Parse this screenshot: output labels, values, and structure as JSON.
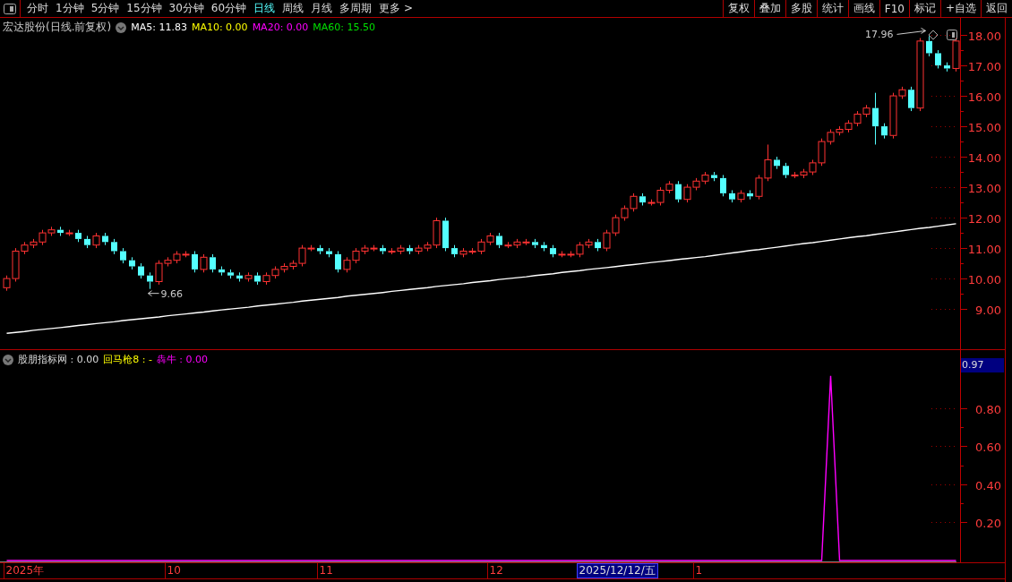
{
  "toolbar": {
    "periods": [
      {
        "label": "分时",
        "selected": false
      },
      {
        "label": "1分钟",
        "selected": false
      },
      {
        "label": "5分钟",
        "selected": false
      },
      {
        "label": "15分钟",
        "selected": false
      },
      {
        "label": "30分钟",
        "selected": false
      },
      {
        "label": "60分钟",
        "selected": false
      },
      {
        "label": "日线",
        "selected": true
      },
      {
        "label": "周线",
        "selected": false
      },
      {
        "label": "月线",
        "selected": false
      },
      {
        "label": "多周期",
        "selected": false
      },
      {
        "label": "更多 >",
        "selected": false
      }
    ],
    "buttons": [
      "复权",
      "叠加",
      "多股",
      "统计",
      "画线",
      "F10",
      "标记",
      "+自选",
      "返回"
    ]
  },
  "price_panel": {
    "title": "宏达股份(日线.前复权)",
    "legend": [
      {
        "label": "MA5: 11.83",
        "color": "#ffffff"
      },
      {
        "label": "MA10: 0.00",
        "color": "#ffff00"
      },
      {
        "label": "MA20: 0.00",
        "color": "#ff00ff"
      },
      {
        "label": "MA60: 15.50",
        "color": "#00e000"
      }
    ],
    "high_mark": "17.96",
    "low_mark": "9.66",
    "chart_data": {
      "type": "line",
      "ylim": [
        7.68,
        18.56
      ],
      "yticks": [
        {
          "value": 9,
          "label": "9.00"
        },
        {
          "value": 10,
          "label": "10.00"
        },
        {
          "value": 11,
          "label": "11.00"
        },
        {
          "value": 12,
          "label": "12.00"
        },
        {
          "value": 13,
          "label": "13.00"
        },
        {
          "value": 14,
          "label": "14.00"
        },
        {
          "value": 15,
          "label": "15.00"
        },
        {
          "value": 16,
          "label": "16.00"
        },
        {
          "value": 17,
          "label": "17.00"
        },
        {
          "value": 18,
          "label": "18.00"
        }
      ],
      "series": [
        {
          "color": "#ffffff",
          "values": [
            8.2,
            8.23,
            8.26,
            8.3,
            8.33,
            8.36,
            8.39,
            8.42,
            8.46,
            8.49,
            8.52,
            8.55,
            8.58,
            8.62,
            8.65,
            8.68,
            8.71,
            8.74,
            8.78,
            8.81,
            8.84,
            8.87,
            8.9,
            8.94,
            8.97,
            9.0,
            9.03,
            9.06,
            9.1,
            9.13,
            9.16,
            9.19,
            9.22,
            9.26,
            9.29,
            9.32,
            9.35,
            9.38,
            9.42,
            9.45,
            9.48,
            9.51,
            9.54,
            9.58,
            9.61,
            9.64,
            9.67,
            9.7,
            9.74,
            9.77,
            9.8,
            9.83,
            9.87,
            9.9,
            9.93,
            9.97,
            10.0,
            10.03,
            10.06,
            10.1,
            10.13,
            10.16,
            10.2,
            10.23,
            10.26,
            10.3,
            10.33,
            10.36,
            10.39,
            10.43,
            10.46,
            10.49,
            10.53,
            10.56,
            10.59,
            10.63,
            10.66,
            10.69,
            10.72,
            10.76,
            10.8,
            10.84,
            10.88,
            10.92,
            10.95,
            10.99,
            11.03,
            11.07,
            11.11,
            11.15,
            11.18,
            11.22,
            11.26,
            11.3,
            11.34,
            11.38,
            11.41,
            11.45,
            11.49,
            11.53,
            11.57,
            11.61,
            11.65,
            11.68,
            11.72,
            11.76,
            11.8
          ]
        }
      ]
    }
  },
  "indicator_panel": {
    "legend": [
      {
        "label": "股朋指标网",
        "value": ": 0.00",
        "color": "#dddddd"
      },
      {
        "label": "回马枪8",
        "value": ": -",
        "color": "#ffff00"
      },
      {
        "label": "犇牛",
        "value": ": 0.00",
        "color": "#ff00ff"
      }
    ],
    "readout": "0.97",
    "chart_data": {
      "type": "line",
      "ylim": [
        0,
        1.1
      ],
      "yticks": [
        {
          "value": 0.2,
          "label": "0.20"
        },
        {
          "value": 0.4,
          "label": "0.40"
        },
        {
          "value": 0.6,
          "label": "0.60"
        },
        {
          "value": 0.8,
          "label": "0.80"
        }
      ],
      "series": [
        {
          "color": "#ff00ff",
          "values": [
            0,
            0,
            0,
            0,
            0,
            0,
            0,
            0,
            0,
            0,
            0,
            0,
            0,
            0,
            0,
            0,
            0,
            0,
            0,
            0,
            0,
            0,
            0,
            0,
            0,
            0,
            0,
            0,
            0,
            0,
            0,
            0,
            0,
            0,
            0,
            0,
            0,
            0,
            0,
            0,
            0,
            0,
            0,
            0,
            0,
            0,
            0,
            0,
            0,
            0,
            0,
            0,
            0,
            0,
            0,
            0,
            0,
            0,
            0,
            0,
            0,
            0,
            0,
            0,
            0,
            0,
            0,
            0,
            0,
            0,
            0,
            0,
            0,
            0,
            0,
            0,
            0,
            0,
            0,
            0,
            0,
            0,
            0,
            0,
            0,
            0,
            0,
            0,
            0,
            0,
            0,
            0,
            0.97,
            0,
            0,
            0,
            0,
            0,
            0,
            0,
            0,
            0,
            0,
            0,
            0,
            0,
            0
          ]
        }
      ]
    }
  },
  "time_axis": [
    {
      "label": "2025年",
      "kind": "date"
    },
    {
      "label": "10",
      "kind": "date"
    },
    {
      "label": "11",
      "kind": "date"
    },
    {
      "label": "12",
      "kind": "date"
    },
    {
      "label": "2025/12/12/五",
      "kind": "cursor"
    },
    {
      "label": "1",
      "kind": "date"
    }
  ]
}
